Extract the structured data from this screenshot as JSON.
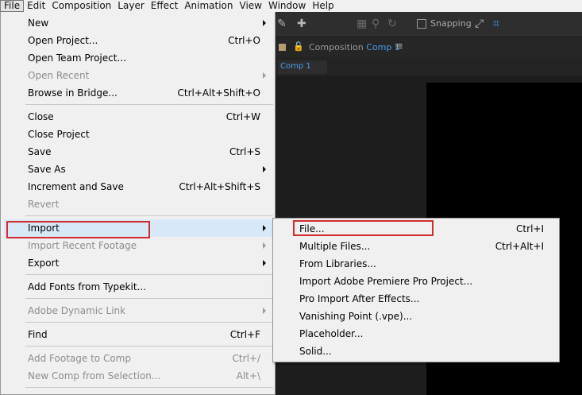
{
  "menubar": [
    "File",
    "Edit",
    "Composition",
    "Layer",
    "Effect",
    "Animation",
    "View",
    "Window",
    "Help"
  ],
  "toolbar": {
    "snapping_label": "Snapping",
    "icons": [
      "brush-icon",
      "pin-icon",
      "shape-icon",
      "puppet-icon",
      "snap-options-icon",
      "snap-grid-icon"
    ]
  },
  "composition_panel": {
    "header_label": "Composition",
    "comp_name": "Comp 1",
    "tab_label": "Comp 1",
    "viewer_color": "#000000"
  },
  "file_menu": {
    "items": [
      {
        "label": "New",
        "shortcut": "",
        "submenu": true,
        "disabled": false
      },
      {
        "label": "Open Project...",
        "shortcut": "Ctrl+O",
        "submenu": false,
        "disabled": false
      },
      {
        "label": "Open Team Project...",
        "shortcut": "",
        "submenu": false,
        "disabled": false
      },
      {
        "label": "Open Recent",
        "shortcut": "",
        "submenu": true,
        "disabled": true
      },
      {
        "label": "Browse in Bridge...",
        "shortcut": "Ctrl+Alt+Shift+O",
        "submenu": false,
        "disabled": false
      },
      {
        "label": "Close",
        "shortcut": "Ctrl+W",
        "submenu": false,
        "disabled": false
      },
      {
        "label": "Close Project",
        "shortcut": "",
        "submenu": false,
        "disabled": false
      },
      {
        "label": "Save",
        "shortcut": "Ctrl+S",
        "submenu": false,
        "disabled": false
      },
      {
        "label": "Save As",
        "shortcut": "",
        "submenu": true,
        "disabled": false
      },
      {
        "label": "Increment and Save",
        "shortcut": "Ctrl+Alt+Shift+S",
        "submenu": false,
        "disabled": false
      },
      {
        "label": "Revert",
        "shortcut": "",
        "submenu": false,
        "disabled": true
      },
      {
        "label": "Import",
        "shortcut": "",
        "submenu": true,
        "disabled": false,
        "highlighted": true
      },
      {
        "label": "Import Recent Footage",
        "shortcut": "",
        "submenu": true,
        "disabled": true
      },
      {
        "label": "Export",
        "shortcut": "",
        "submenu": true,
        "disabled": false
      },
      {
        "label": "Add Fonts from Typekit...",
        "shortcut": "",
        "submenu": false,
        "disabled": false
      },
      {
        "label": "Adobe Dynamic Link",
        "shortcut": "",
        "submenu": true,
        "disabled": true
      },
      {
        "label": "Find",
        "shortcut": "Ctrl+F",
        "submenu": false,
        "disabled": false
      },
      {
        "label": "Add Footage to Comp",
        "shortcut": "Ctrl+/",
        "submenu": false,
        "disabled": true
      },
      {
        "label": "New Comp from Selection...",
        "shortcut": "Alt+\\",
        "submenu": false,
        "disabled": true
      }
    ]
  },
  "import_menu": {
    "items": [
      {
        "label": "File...",
        "shortcut": "Ctrl+I",
        "highlighted": true
      },
      {
        "label": "Multiple Files...",
        "shortcut": "Ctrl+Alt+I"
      },
      {
        "label": "From Libraries...",
        "shortcut": ""
      },
      {
        "label": "Import Adobe Premiere Pro Project...",
        "shortcut": ""
      },
      {
        "label": "Pro Import After Effects...",
        "shortcut": ""
      },
      {
        "label": "Vanishing Point (.vpe)...",
        "shortcut": ""
      },
      {
        "label": "Placeholder...",
        "shortcut": ""
      },
      {
        "label": "Solid...",
        "shortcut": ""
      }
    ]
  },
  "highlight_color": "#d12a2f"
}
